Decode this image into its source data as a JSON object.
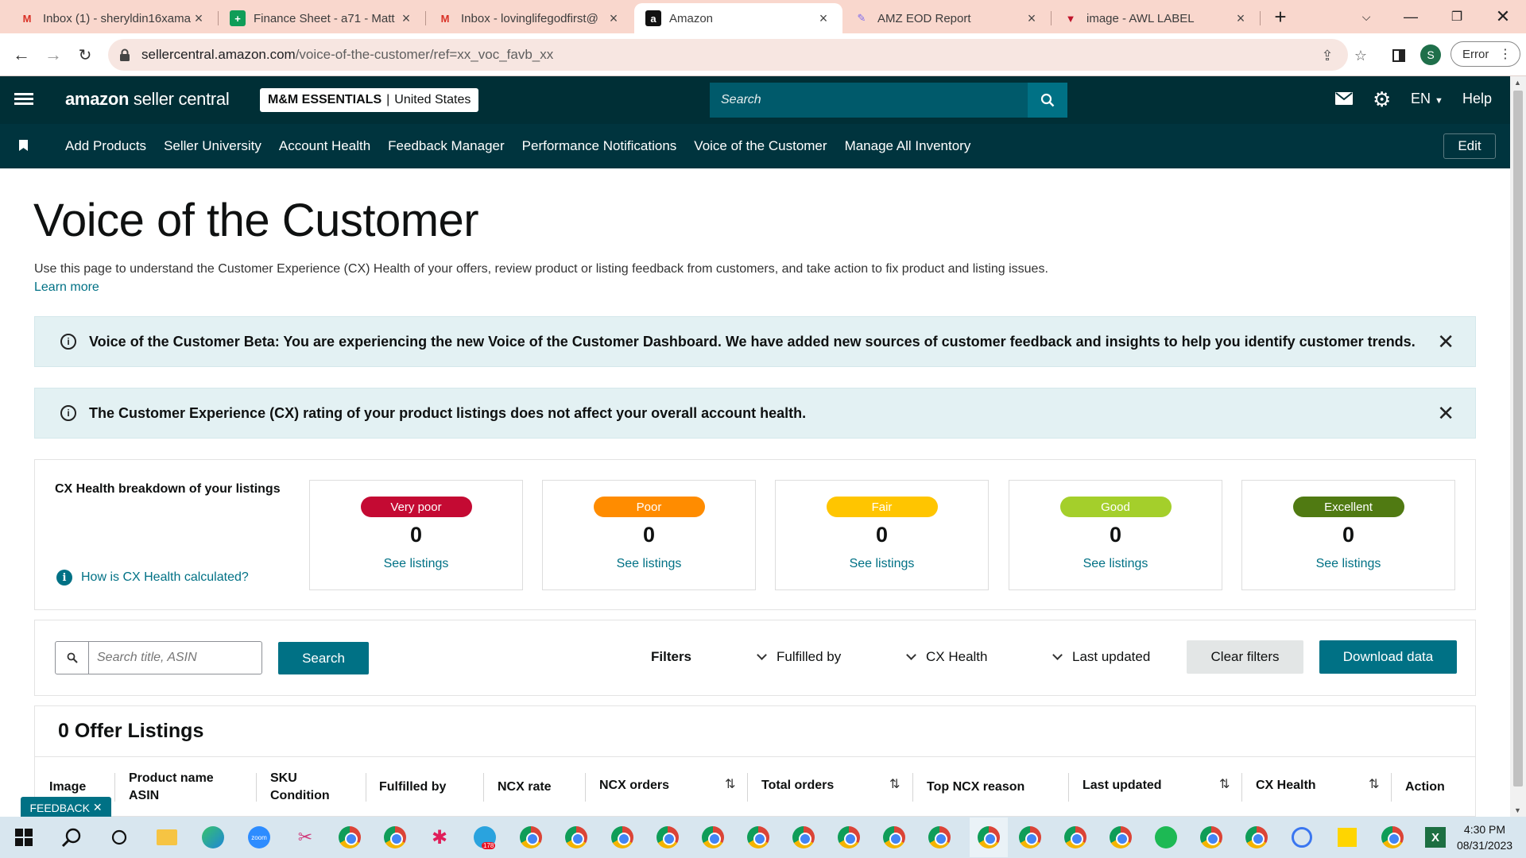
{
  "browser": {
    "tabs": [
      {
        "title": "Inbox (1) - sheryldin16xama",
        "icon": "gmail-icon",
        "active": false
      },
      {
        "title": "Finance Sheet - a71 - Matt",
        "icon": "sheets-icon",
        "active": false
      },
      {
        "title": "Inbox - lovinglifegodfirst@",
        "icon": "gmail-icon",
        "active": false
      },
      {
        "title": "Amazon",
        "icon": "amazon-icon",
        "active": true
      },
      {
        "title": "AMZ EOD Report",
        "icon": "clickup-icon",
        "active": false
      },
      {
        "title": "image - AWL LABEL",
        "icon": "awl-icon",
        "active": false
      }
    ],
    "url_domain": "sellercentral.amazon.com",
    "url_path": "/voice-of-the-customer/ref=xx_voc_favb_xx",
    "profile_initial": "S",
    "error_label": "Error"
  },
  "header": {
    "logo_bold": "amazon",
    "logo_rest": " seller central",
    "store_name": "M&M ESSENTIALS",
    "store_region": "United States",
    "search_placeholder": "Search",
    "language": "EN",
    "help": "Help"
  },
  "nav": {
    "items": [
      "Add Products",
      "Seller University",
      "Account Health",
      "Feedback Manager",
      "Performance Notifications",
      "Voice of the Customer",
      "Manage All Inventory"
    ],
    "edit": "Edit"
  },
  "page": {
    "title": "Voice of the Customer",
    "intro": "Use this page to understand the Customer Experience (CX) Health of your offers, review product or listing feedback from customers, and take action to fix product and listing issues.",
    "learn_more": "Learn more"
  },
  "banners": [
    "Voice of the Customer Beta: You are experiencing the new Voice of the Customer Dashboard. We have added new sources of customer feedback and insights to help you identify customer trends.",
    "The Customer Experience (CX) rating of your product listings does not affect your overall account health."
  ],
  "cx": {
    "title": "CX Health breakdown of your listings",
    "how_link": "How is CX Health calculated?",
    "categories": [
      {
        "label": "Very poor",
        "count": "0",
        "link": "See listings",
        "color": "#c40a33"
      },
      {
        "label": "Poor",
        "count": "0",
        "link": "See listings",
        "color": "#ff8c00"
      },
      {
        "label": "Fair",
        "count": "0",
        "link": "See listings",
        "color": "#ffc500"
      },
      {
        "label": "Good",
        "count": "0",
        "link": "See listings",
        "color": "#a4cf2b"
      },
      {
        "label": "Excellent",
        "count": "0",
        "link": "See listings",
        "color": "#507a12"
      }
    ]
  },
  "filters": {
    "search_placeholder": "Search title, ASIN",
    "search_button": "Search",
    "label": "Filters",
    "dropdowns": [
      "Fulfilled by",
      "CX Health",
      "Last updated"
    ],
    "clear": "Clear filters",
    "download": "Download data"
  },
  "listings": {
    "count_title": "0 Offer Listings",
    "columns": [
      {
        "line1": "Image",
        "line2": ""
      },
      {
        "line1": "Product name",
        "line2": "ASIN"
      },
      {
        "line1": "SKU",
        "line2": "Condition"
      },
      {
        "line1": "Fulfilled by",
        "line2": ""
      },
      {
        "line1": "NCX rate",
        "line2": ""
      },
      {
        "line1": "NCX orders",
        "line2": ""
      },
      {
        "line1": "Total orders",
        "line2": ""
      },
      {
        "line1": "Top NCX reason",
        "line2": ""
      },
      {
        "line1": "Last updated",
        "line2": ""
      },
      {
        "line1": "CX Health",
        "line2": ""
      },
      {
        "line1": "Action",
        "line2": ""
      }
    ]
  },
  "feedback": "FEEDBACK",
  "taskbar": {
    "time": "4:30 PM",
    "date": "08/31/2023",
    "telegram_badge": "178"
  },
  "colors": {
    "header_bg": "#002f36",
    "nav_bg": "#00343e",
    "accent": "#007185",
    "banner_bg": "#e3f1f3",
    "tabbar_bg": "#f9d7cd"
  }
}
